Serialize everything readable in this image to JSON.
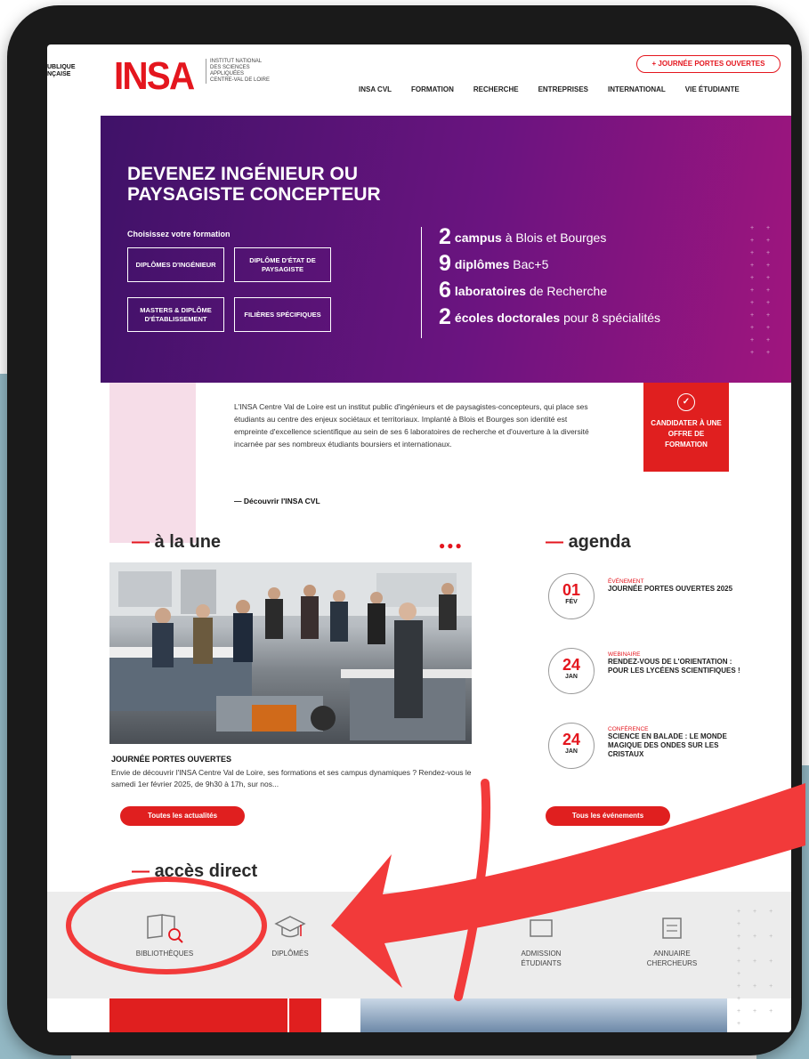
{
  "header": {
    "republique": [
      "UBLIQUE",
      "NÇAISE"
    ],
    "logo": "INSA",
    "logo_sub": [
      "INSTITUT NATIONAL",
      "DES SCIENCES",
      "APPLIQUÉES",
      "CENTRE-VAL DE LOIRE"
    ],
    "open_day_button": "+ JOURNÉE PORTES OUVERTES",
    "nav": [
      "INSA CVL",
      "FORMATION",
      "RECHERCHE",
      "ENTREPRISES",
      "INTERNATIONAL",
      "VIE ÉTUDIANTE"
    ]
  },
  "hero": {
    "title": "DEVENEZ INGÉNIEUR OU PAYSAGISTE CONCEPTEUR",
    "choose_label": "Choisissez votre formation",
    "buttons": [
      "DIPLÔMES D'INGÉNIEUR",
      "DIPLÔME D'ÉTAT DE PAYSAGISTE",
      "MASTERS & DIPLÔME D'ÉTABLISSEMENT",
      "FILIÈRES SPÉCIFIQUES"
    ],
    "stats": [
      {
        "number": "2",
        "bold": "campus",
        "rest": "à Blois et Bourges"
      },
      {
        "number": "9",
        "bold": "diplômes",
        "rest": "Bac+5"
      },
      {
        "number": "6",
        "bold": "laboratoires",
        "rest": "de Recherche"
      },
      {
        "number": "2",
        "bold": "écoles doctorales",
        "rest": "pour 8 spécialités"
      }
    ]
  },
  "intro": {
    "text": "L'INSA Centre Val de Loire est un institut public d'ingénieurs et de paysagistes-concepteurs, qui place ses étudiants au centre des enjeux sociétaux et territoriaux. Implanté à Blois et Bourges son identité est empreinte d'excellence scientifique au sein de ses 6 laboratoires de recherche et d'ouverture à la diversité incarnée par ses nombreux étudiants boursiers et internationaux.",
    "link": "— Découvrir l'INSA CVL",
    "cta": "CANDIDATER À UNE OFFRE DE FORMATION"
  },
  "news": {
    "heading": "à la une",
    "title": "JOURNÉE PORTES OUVERTES",
    "text": "Envie de découvrir l'INSA Centre Val de Loire, ses formations et ses campus dynamiques ? Rendez-vous le samedi 1er février 2025, de 9h30 à 17h, sur nos...",
    "button": "Toutes les actualités"
  },
  "agenda": {
    "heading": "agenda",
    "events": [
      {
        "day": "01",
        "month": "FÉV",
        "kind": "ÉVÉNEMENT",
        "title": "JOURNÉE PORTES OUVERTES 2025"
      },
      {
        "day": "24",
        "month": "JAN",
        "kind": "WEBINAIRE",
        "title": "RENDEZ-VOUS DE L'ORIENTATION : POUR LES LYCÉENS SCIENTIFIQUES !"
      },
      {
        "day": "24",
        "month": "JAN",
        "kind": "CONFÉRENCE",
        "title": "SCIENCE EN BALADE : LE MONDE MAGIQUE DES ONDES SUR LES CRISTAUX"
      }
    ],
    "button": "Tous les événements"
  },
  "quick_access": {
    "heading": "accès direct",
    "items": [
      "BIBLIOTHÈQUES",
      "DIPLÔMÉS",
      "ADMISSION ÉTUDIANTS",
      "ANNUAIRE CHERCHEURS"
    ]
  },
  "colors": {
    "brand_red": "#e4161e",
    "hero_start": "#3f1268",
    "hero_end": "#a0157e",
    "background_teal": "#93b8c4"
  }
}
